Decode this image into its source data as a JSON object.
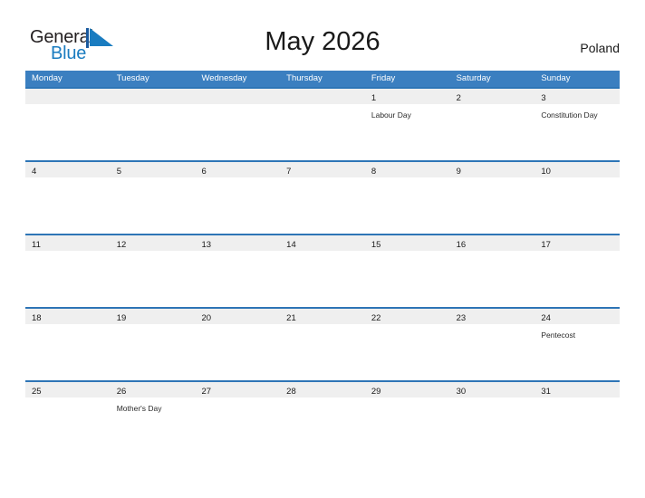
{
  "brand": {
    "name_part1": "General",
    "name_part2": "Blue",
    "flag_icon": "triangle-flag-icon",
    "color_dark": "#231f20",
    "color_blue": "#1a7cc0"
  },
  "header": {
    "title": "May 2026",
    "country": "Poland"
  },
  "theme": {
    "header_blue": "#3b7fc0",
    "row_rule_blue": "#2e75b6",
    "date_band_gray": "#efefef",
    "text_dark": "#1a1a1a"
  },
  "calendar": {
    "weekdays": [
      "Monday",
      "Tuesday",
      "Wednesday",
      "Thursday",
      "Friday",
      "Saturday",
      "Sunday"
    ],
    "weeks": [
      [
        {
          "date": "",
          "event": ""
        },
        {
          "date": "",
          "event": ""
        },
        {
          "date": "",
          "event": ""
        },
        {
          "date": "",
          "event": ""
        },
        {
          "date": "1",
          "event": "Labour Day"
        },
        {
          "date": "2",
          "event": ""
        },
        {
          "date": "3",
          "event": "Constitution Day"
        }
      ],
      [
        {
          "date": "4",
          "event": ""
        },
        {
          "date": "5",
          "event": ""
        },
        {
          "date": "6",
          "event": ""
        },
        {
          "date": "7",
          "event": ""
        },
        {
          "date": "8",
          "event": ""
        },
        {
          "date": "9",
          "event": ""
        },
        {
          "date": "10",
          "event": ""
        }
      ],
      [
        {
          "date": "11",
          "event": ""
        },
        {
          "date": "12",
          "event": ""
        },
        {
          "date": "13",
          "event": ""
        },
        {
          "date": "14",
          "event": ""
        },
        {
          "date": "15",
          "event": ""
        },
        {
          "date": "16",
          "event": ""
        },
        {
          "date": "17",
          "event": ""
        }
      ],
      [
        {
          "date": "18",
          "event": ""
        },
        {
          "date": "19",
          "event": ""
        },
        {
          "date": "20",
          "event": ""
        },
        {
          "date": "21",
          "event": ""
        },
        {
          "date": "22",
          "event": ""
        },
        {
          "date": "23",
          "event": ""
        },
        {
          "date": "24",
          "event": "Pentecost"
        }
      ],
      [
        {
          "date": "25",
          "event": ""
        },
        {
          "date": "26",
          "event": "Mother's Day"
        },
        {
          "date": "27",
          "event": ""
        },
        {
          "date": "28",
          "event": ""
        },
        {
          "date": "29",
          "event": ""
        },
        {
          "date": "30",
          "event": ""
        },
        {
          "date": "31",
          "event": ""
        }
      ]
    ]
  }
}
